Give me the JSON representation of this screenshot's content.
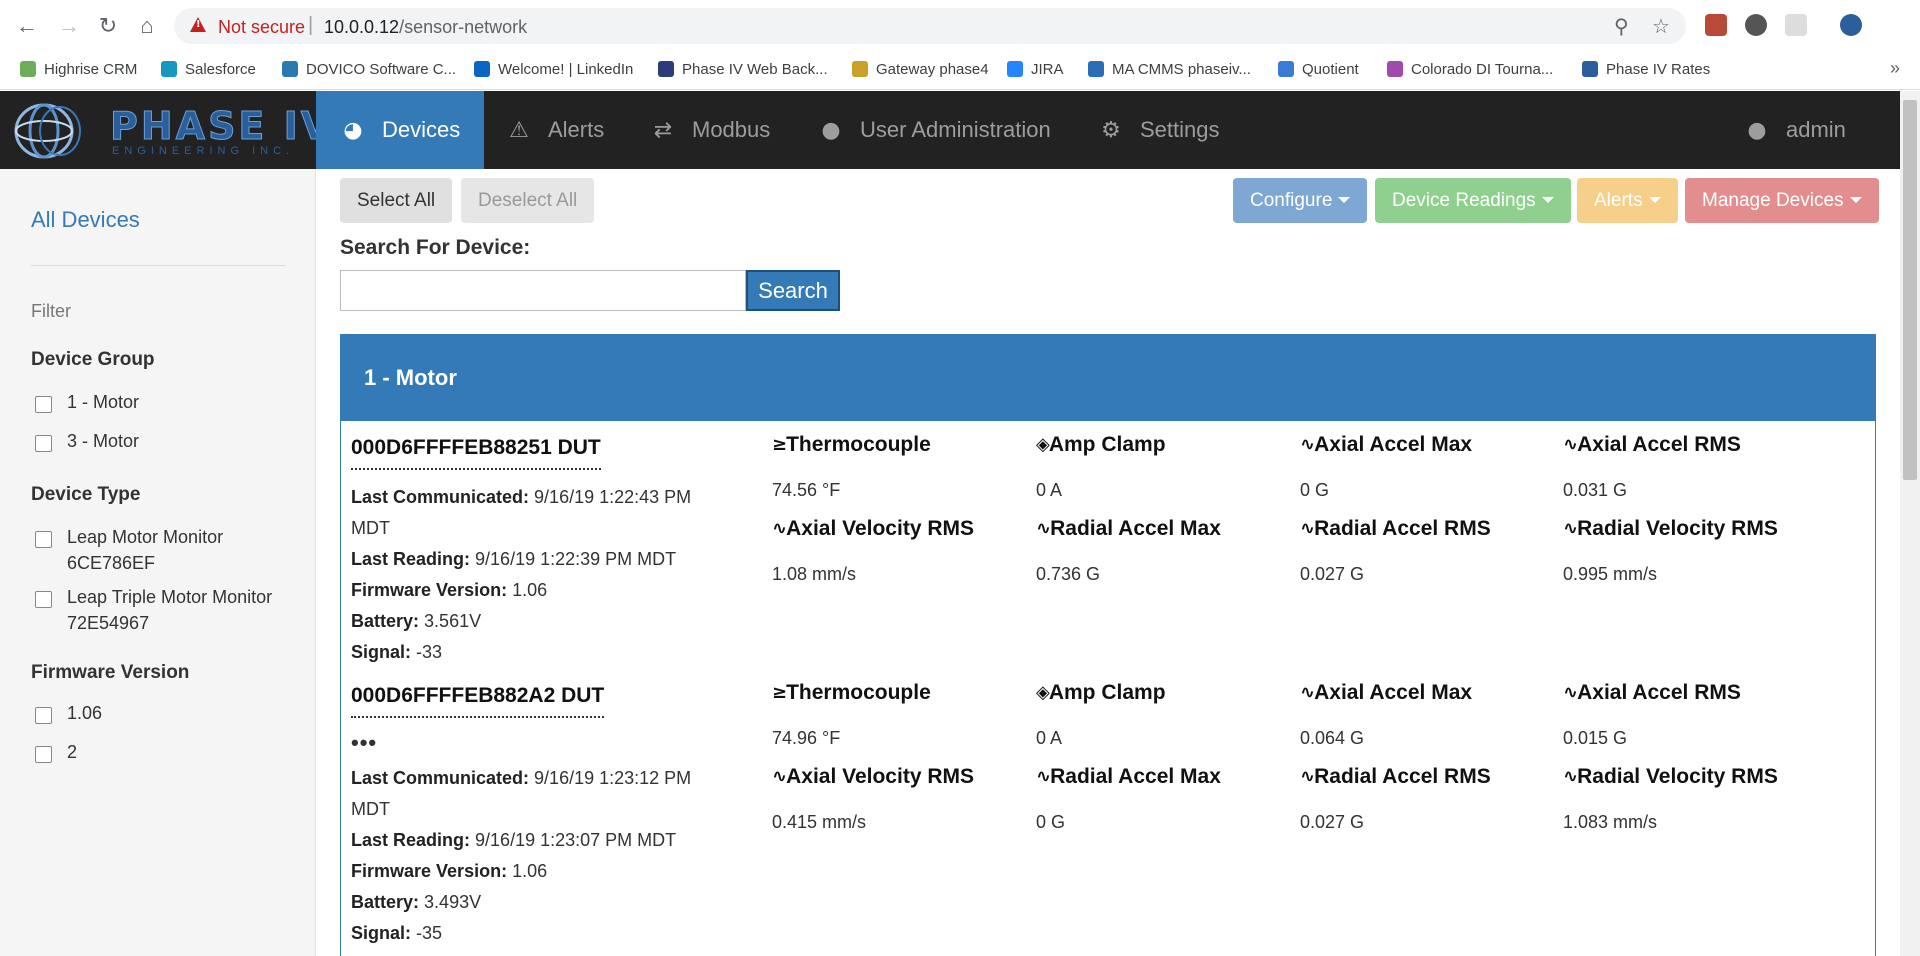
{
  "browser": {
    "not_secure": "Not secure",
    "url_host": "10.0.0.12",
    "url_path": "/sensor-network",
    "bookmarks": [
      {
        "label": "Highrise CRM",
        "color": "#6cae5a"
      },
      {
        "label": "Salesforce",
        "color": "#1798c1"
      },
      {
        "label": "DOVICO Software C...",
        "color": "#2a7ab0"
      },
      {
        "label": "Welcome! | LinkedIn",
        "color": "#0a66c2"
      },
      {
        "label": "Phase IV Web Back...",
        "color": "#2a3d7a"
      },
      {
        "label": "Gateway phase4",
        "color": "#c8a02a"
      },
      {
        "label": "JIRA",
        "color": "#2684ff"
      },
      {
        "label": "MA CMMS phaseiv...",
        "color": "#2a6fb5"
      },
      {
        "label": "Quotient",
        "color": "#3a7bd5"
      },
      {
        "label": "Colorado DI Tourna...",
        "color": "#a04ab0"
      },
      {
        "label": "Phase IV Rates",
        "color": "#2a5f9b"
      }
    ],
    "more": "»"
  },
  "nav": {
    "items": [
      {
        "label": "Devices",
        "icon": "dashboard-icon"
      },
      {
        "label": "Alerts",
        "icon": "warning-icon"
      },
      {
        "label": "Modbus",
        "icon": "transfer-icon"
      },
      {
        "label": "User Administration",
        "icon": "user-icon"
      },
      {
        "label": "Settings",
        "icon": "gear-icon"
      }
    ],
    "user": "admin"
  },
  "sidebar": {
    "all_devices": "All Devices",
    "filter": "Filter",
    "device_group": {
      "heading": "Device Group",
      "options": [
        "1 - Motor",
        "3 - Motor"
      ]
    },
    "device_type": {
      "heading": "Device Type",
      "options": [
        "Leap Motor Monitor 6CE786EF",
        "Leap Triple Motor Monitor 72E54967"
      ]
    },
    "firmware_version": {
      "heading": "Firmware Version",
      "options": [
        "1.06",
        "2"
      ]
    }
  },
  "toolbar": {
    "select_all": "Select All",
    "deselect_all": "Deselect All",
    "configure": "Configure",
    "device_readings": "Device Readings",
    "alerts": "Alerts",
    "manage_devices": "Manage Devices",
    "colors": {
      "configure": "#7fa7d3",
      "device_readings": "#8fd08f",
      "alerts": "#f6d08a",
      "manage_devices": "#e28e8e"
    }
  },
  "search": {
    "label": "Search For Device:",
    "value": "",
    "button": "Search"
  },
  "group": {
    "title": "1 - Motor",
    "devices": [
      {
        "name": "000D6FFFFEB88251 DUT",
        "more": "",
        "last_communicated_label": "Last Communicated:",
        "last_communicated": "9/16/19 1:22:43 PM",
        "last_communicated_tz": "MDT",
        "last_reading_label": "Last Reading:",
        "last_reading": "9/16/19 1:22:39 PM MDT",
        "firmware_label": "Firmware Version:",
        "firmware": "1.06",
        "battery_label": "Battery:",
        "battery": "3.561V",
        "signal_label": "Signal:",
        "signal": "-33",
        "metrics": [
          {
            "title": "Thermocouple",
            "value": "74.56 °F",
            "icon": "thermometer-icon"
          },
          {
            "title": "Amp Clamp",
            "value": "0 A",
            "icon": "amp-clamp-icon"
          },
          {
            "title": "Axial Accel Max",
            "value": "0 G",
            "icon": "waveform-icon"
          },
          {
            "title": "Axial Accel RMS",
            "value": "0.031 G",
            "icon": "waveform-icon"
          },
          {
            "title": "Axial Velocity RMS",
            "value": "1.08 mm/s",
            "icon": "waveform-icon"
          },
          {
            "title": "Radial Accel Max",
            "value": "0.736 G",
            "icon": "waveform-icon"
          },
          {
            "title": "Radial Accel RMS",
            "value": "0.027 G",
            "icon": "waveform-icon"
          },
          {
            "title": "Radial Velocity RMS",
            "value": "0.995 mm/s",
            "icon": "waveform-icon"
          }
        ]
      },
      {
        "name": "000D6FFFFEB882A2 DUT",
        "more": "•••",
        "last_communicated_label": "Last Communicated:",
        "last_communicated": "9/16/19 1:23:12 PM",
        "last_communicated_tz": "MDT",
        "last_reading_label": "Last Reading:",
        "last_reading": "9/16/19 1:23:07 PM MDT",
        "firmware_label": "Firmware Version:",
        "firmware": "1.06",
        "battery_label": "Battery:",
        "battery": "3.493V",
        "signal_label": "Signal:",
        "signal": "-35",
        "metrics": [
          {
            "title": "Thermocouple",
            "value": "74.96 °F",
            "icon": "thermometer-icon"
          },
          {
            "title": "Amp Clamp",
            "value": "0 A",
            "icon": "amp-clamp-icon"
          },
          {
            "title": "Axial Accel Max",
            "value": "0.064 G",
            "icon": "waveform-icon"
          },
          {
            "title": "Axial Accel RMS",
            "value": "0.015 G",
            "icon": "waveform-icon"
          },
          {
            "title": "Axial Velocity RMS",
            "value": "0.415 mm/s",
            "icon": "waveform-icon"
          },
          {
            "title": "Radial Accel Max",
            "value": "0 G",
            "icon": "waveform-icon"
          },
          {
            "title": "Radial Accel RMS",
            "value": "0.027 G",
            "icon": "waveform-icon"
          },
          {
            "title": "Radial Velocity RMS",
            "value": "1.083 mm/s",
            "icon": "waveform-icon"
          }
        ]
      }
    ]
  }
}
